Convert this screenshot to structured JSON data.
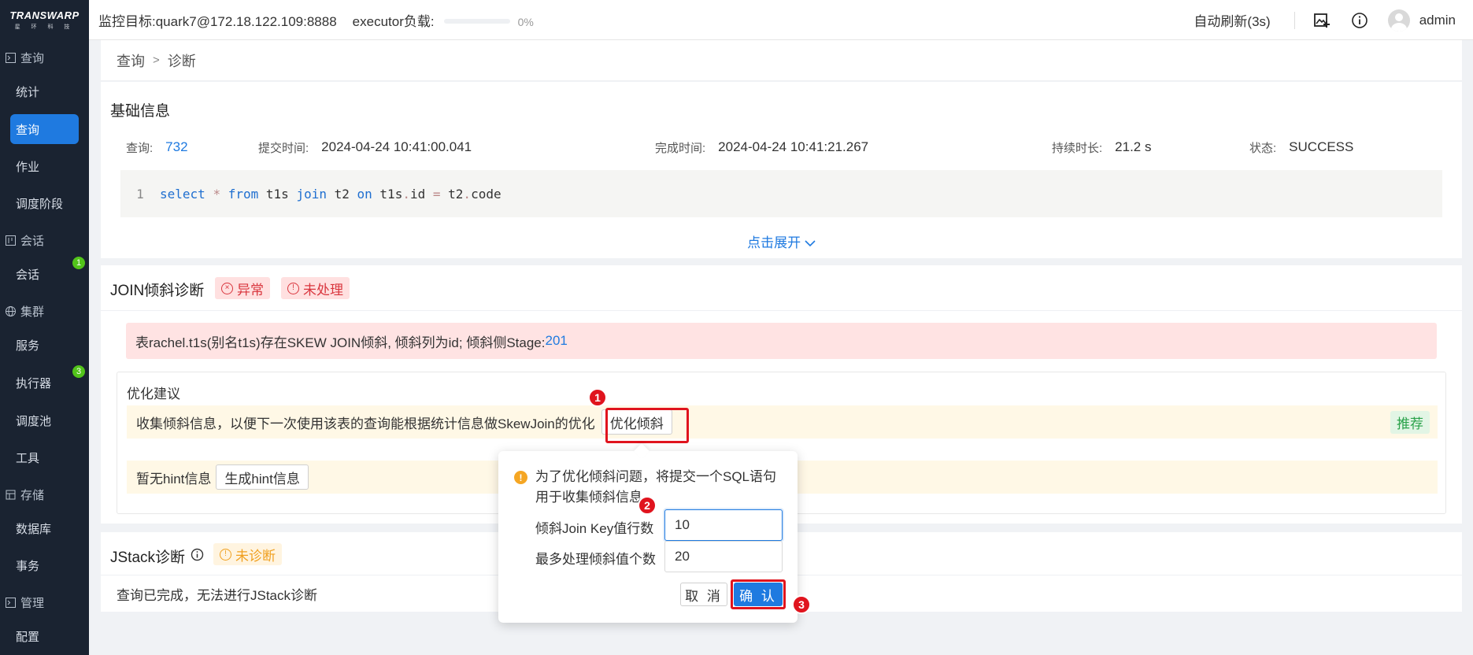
{
  "logo": {
    "brand": "TRANSWARP",
    "sub": "星 环 科 技"
  },
  "sidebar": {
    "groups": [
      {
        "label": "查询",
        "icon": "terminal-icon"
      },
      {
        "label": "会话",
        "icon": "session-icon"
      },
      {
        "label": "集群",
        "icon": "globe-icon"
      },
      {
        "label": "存储",
        "icon": "database-icon"
      },
      {
        "label": "管理",
        "icon": "terminal-icon"
      }
    ],
    "items": [
      {
        "label": "统计"
      },
      {
        "label": "查询"
      },
      {
        "label": "作业"
      },
      {
        "label": "调度阶段"
      },
      {
        "label": "会话",
        "badge": "1"
      },
      {
        "label": "服务"
      },
      {
        "label": "执行器",
        "badge": "3"
      },
      {
        "label": "调度池"
      },
      {
        "label": "工具"
      },
      {
        "label": "数据库"
      },
      {
        "label": "事务"
      },
      {
        "label": "配置"
      }
    ]
  },
  "header": {
    "target": "监控目标:quark7@172.18.122.109:8888",
    "executor_label": "executor负载:",
    "executor_pct": "0%",
    "executor_progress": 0,
    "refresh": "自动刷新(3s)",
    "user": "admin"
  },
  "breadcrumb": {
    "parent": "查询",
    "sep": ">",
    "current": "诊断"
  },
  "basic": {
    "title": "基础信息",
    "query_label": "查询:",
    "query_id": "732",
    "submit_label": "提交时间:",
    "submit_time": "2024-04-24 10:41:00.041",
    "finish_label": "完成时间:",
    "finish_time": "2024-04-24 10:41:21.267",
    "duration_label": "持续时长:",
    "duration": "21.2 s",
    "status_label": "状态:",
    "status": "SUCCESS",
    "code": {
      "line": "1",
      "t1": "select",
      "t2": "*",
      "t3": "from",
      "t4": "t1s",
      "t5": "join",
      "t6": "t2",
      "t7": "on",
      "t8": "t1s",
      "t9": ".",
      "t10": "id",
      "t11": "=",
      "t12": "t2",
      "t13": ".",
      "t14": "code"
    },
    "expand": "点击展开"
  },
  "join": {
    "title": "JOIN倾斜诊断",
    "tag_abnormal": "异常",
    "tag_unhandled": "未处理",
    "alert_text": "表rachel.t1s(别名t1s)存在SKEW JOIN倾斜, 倾斜列为id;  倾斜侧Stage:",
    "alert_stage": "201",
    "opt_title": "优化建议",
    "row1_text": "收集倾斜信息，以便下一次使用该表的查询能根据统计信息做SkewJoin的优化",
    "row1_button": "优化倾斜",
    "row1_tag": "推荐",
    "row2_text": "暂无hint信息",
    "row2_button": "生成hint信息"
  },
  "jstack": {
    "title": "JStack诊断",
    "tag": "未诊断",
    "text": "查询已完成，无法进行JStack诊断"
  },
  "popover": {
    "message": "为了优化倾斜问题，将提交一个SQL语句用于收集倾斜信息",
    "field1_label": "倾斜Join Key值行数",
    "field1_value": "10",
    "field2_label": "最多处理倾斜值个数",
    "field2_value": "20",
    "cancel": "取 消",
    "ok": "确 认"
  },
  "steps": [
    "1",
    "2",
    "3"
  ],
  "colors": {
    "accent": "#1f7ae0",
    "sidebar_bg": "#1a2331",
    "highlight": "#e0141e"
  }
}
